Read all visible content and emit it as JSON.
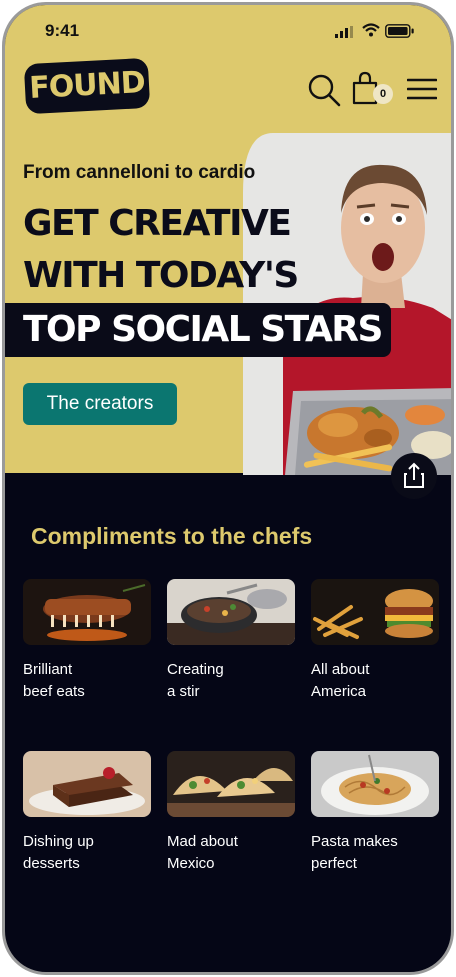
{
  "status_bar": {
    "time": "9:41"
  },
  "header": {
    "logo_text": "FOUND",
    "cart_count": "0",
    "icons": [
      "search-icon",
      "shopping-bag-icon",
      "hamburger-menu-icon"
    ]
  },
  "hero": {
    "kicker": "From cannelloni to cardio",
    "line1": "GET CREATIVE",
    "line2": "WITH TODAY'S",
    "line3": "TOP SOCIAL STARS",
    "cta_label": "The creators",
    "share_icon": "share-icon"
  },
  "section": {
    "title": "Compliments to the chefs",
    "cards": [
      {
        "line1": "Brilliant",
        "line2": "beef eats"
      },
      {
        "line1": "Creating",
        "line2": "a stir"
      },
      {
        "line1": "All about",
        "line2": "America"
      },
      {
        "line1": "Dishing up",
        "line2": "desserts"
      },
      {
        "line1": "Mad about",
        "line2": "Mexico"
      },
      {
        "line1": "Pasta makes",
        "line2": "perfect"
      }
    ]
  },
  "colors": {
    "brand_yellow": "#ddc96d",
    "navy": "#050616",
    "teal_button": "#0b7670"
  }
}
